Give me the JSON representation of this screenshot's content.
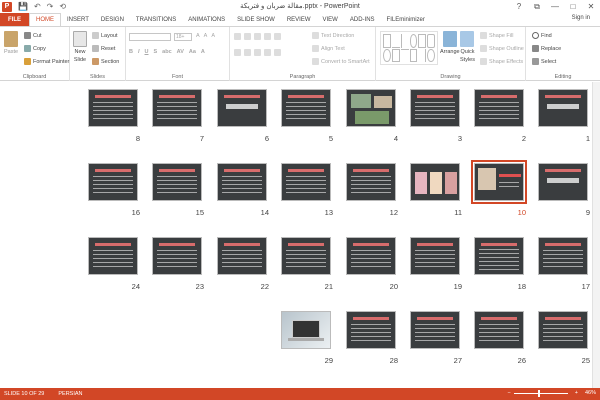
{
  "window": {
    "title": "مقالة ضربان و فتريكة.pptx - PowerPoint"
  },
  "window_controls": {
    "help": "?",
    "restore": "⧉",
    "minimize": "—",
    "maximize": "□",
    "close": "✕"
  },
  "qat": {
    "save": "💾",
    "undo": "↶",
    "redo": "↷",
    "start": "⟲"
  },
  "tabs": [
    "FILE",
    "HOME",
    "INSERT",
    "DESIGN",
    "TRANSITIONS",
    "ANIMATIONS",
    "SLIDE SHOW",
    "REVIEW",
    "VIEW",
    "ADD-INS",
    "FILEminimizer"
  ],
  "active_tab": "HOME",
  "signin": "Sign in",
  "ribbon": {
    "clipboard": {
      "paste": "Paste",
      "cut": "Cut",
      "copy": "Copy",
      "format_painter": "Format Painter",
      "label": "Clipboard"
    },
    "slides": {
      "new_slide": "New",
      "new_slide2": "Slide",
      "layout": "Layout",
      "reset": "Reset",
      "section": "Section",
      "label": "Slides"
    },
    "font": {
      "size": "18+",
      "label": "Font"
    },
    "paragraph": {
      "text_direction": "Text Direction",
      "align_text": "Align Text",
      "smartart": "Convert to SmartArt",
      "label": "Paragraph"
    },
    "drawing": {
      "arrange": "Arrange",
      "quick_styles": "Quick",
      "quick_styles2": "Styles",
      "shape_fill": "Shape Fill",
      "shape_outline": "Shape Outline",
      "shape_effects": "Shape Effects",
      "label": "Drawing"
    },
    "editing": {
      "find": "Find",
      "replace": "Replace",
      "select": "Select",
      "label": "Editing"
    }
  },
  "slides": [
    {
      "n": "1",
      "style": "title"
    },
    {
      "n": "2",
      "style": "text"
    },
    {
      "n": "3",
      "style": "text"
    },
    {
      "n": "4",
      "style": "images"
    },
    {
      "n": "5",
      "style": "text"
    },
    {
      "n": "6",
      "style": "title"
    },
    {
      "n": "7",
      "style": "text"
    },
    {
      "n": "8",
      "style": "text"
    },
    {
      "n": "9",
      "style": "title"
    },
    {
      "n": "10",
      "style": "photo",
      "selected": true
    },
    {
      "n": "11",
      "style": "cards"
    },
    {
      "n": "12",
      "style": "text"
    },
    {
      "n": "13",
      "style": "text"
    },
    {
      "n": "14",
      "style": "text"
    },
    {
      "n": "15",
      "style": "text"
    },
    {
      "n": "16",
      "style": "text"
    },
    {
      "n": "17",
      "style": "text"
    },
    {
      "n": "18",
      "style": "table"
    },
    {
      "n": "19",
      "style": "text"
    },
    {
      "n": "20",
      "style": "text"
    },
    {
      "n": "21",
      "style": "text"
    },
    {
      "n": "22",
      "style": "text"
    },
    {
      "n": "23",
      "style": "text"
    },
    {
      "n": "24",
      "style": "text"
    },
    {
      "n": "25",
      "style": "text"
    },
    {
      "n": "26",
      "style": "text"
    },
    {
      "n": "27",
      "style": "text"
    },
    {
      "n": "28",
      "style": "text"
    },
    {
      "n": "29",
      "style": "laptop"
    }
  ],
  "status": {
    "slide": "SLIDE 10 OF 29",
    "language": "PERSIAN",
    "zoom": "46%"
  },
  "colors": {
    "accent": "#d24726",
    "slide_bg": "#3a3d3f"
  }
}
